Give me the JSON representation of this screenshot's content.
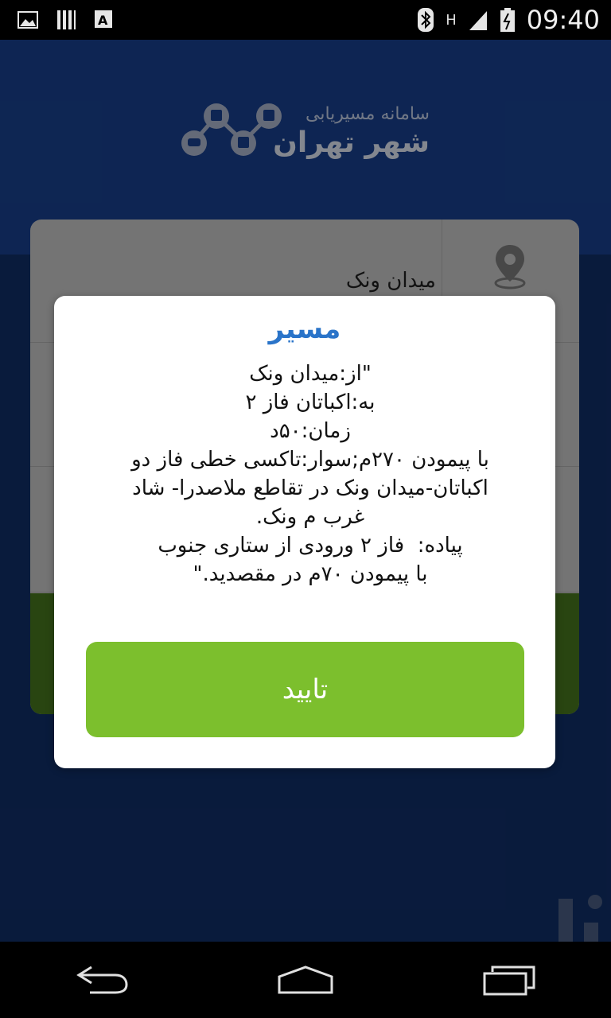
{
  "status_bar": {
    "time": "09:40",
    "network_label": "H",
    "icons": [
      "image-icon",
      "sim-icon",
      "accessibility-icon",
      "bluetooth-icon",
      "signal-icon",
      "battery-icon"
    ]
  },
  "header": {
    "logo_small": "سامانه مسیریابی",
    "logo_big": "شهر تهران"
  },
  "form": {
    "origin_value": "میدان ونک"
  },
  "dialog": {
    "title": "مسیر",
    "lines": [
      "\"از:میدان ونک",
      "به:اکباتان فاز ۲",
      "زمان:۵۰د",
      "با پیمودن ۲۷۰م;سوار:تاکسی خطی فاز دو",
      "اکباتان-میدان ونک در تقاطع ملاصدرا- شاد",
      "غرب م ونک.",
      "پیاده:  فاز ۲ ورودی از ستاری جنوب",
      "با پیمودن ۷۰م در مقصدید.\""
    ],
    "confirm_label": "تایید"
  },
  "colors": {
    "app_bg": "#0f2a5d",
    "header_bg": "#163a80",
    "title_blue": "#2a74c9",
    "button_green": "#7cbf2d"
  },
  "nav": {
    "icons": [
      "back-icon",
      "home-icon",
      "recents-icon"
    ]
  }
}
